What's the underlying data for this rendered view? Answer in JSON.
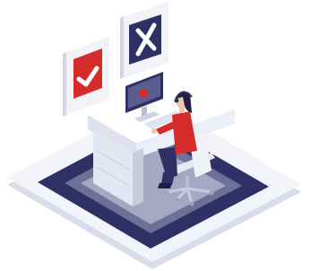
{
  "scene": {
    "subject": "person-at-desk-reviewing-approve-reject",
    "icons": [
      "approve-check-icon",
      "reject-cross-icon"
    ],
    "colors": {
      "navy": "#2f3166",
      "red": "#d62b2b",
      "light_panel": "#eceef8",
      "desk_white": "#f6f7fb",
      "desk_shadow": "#d9dcea",
      "hair": "#1e1f45"
    }
  }
}
